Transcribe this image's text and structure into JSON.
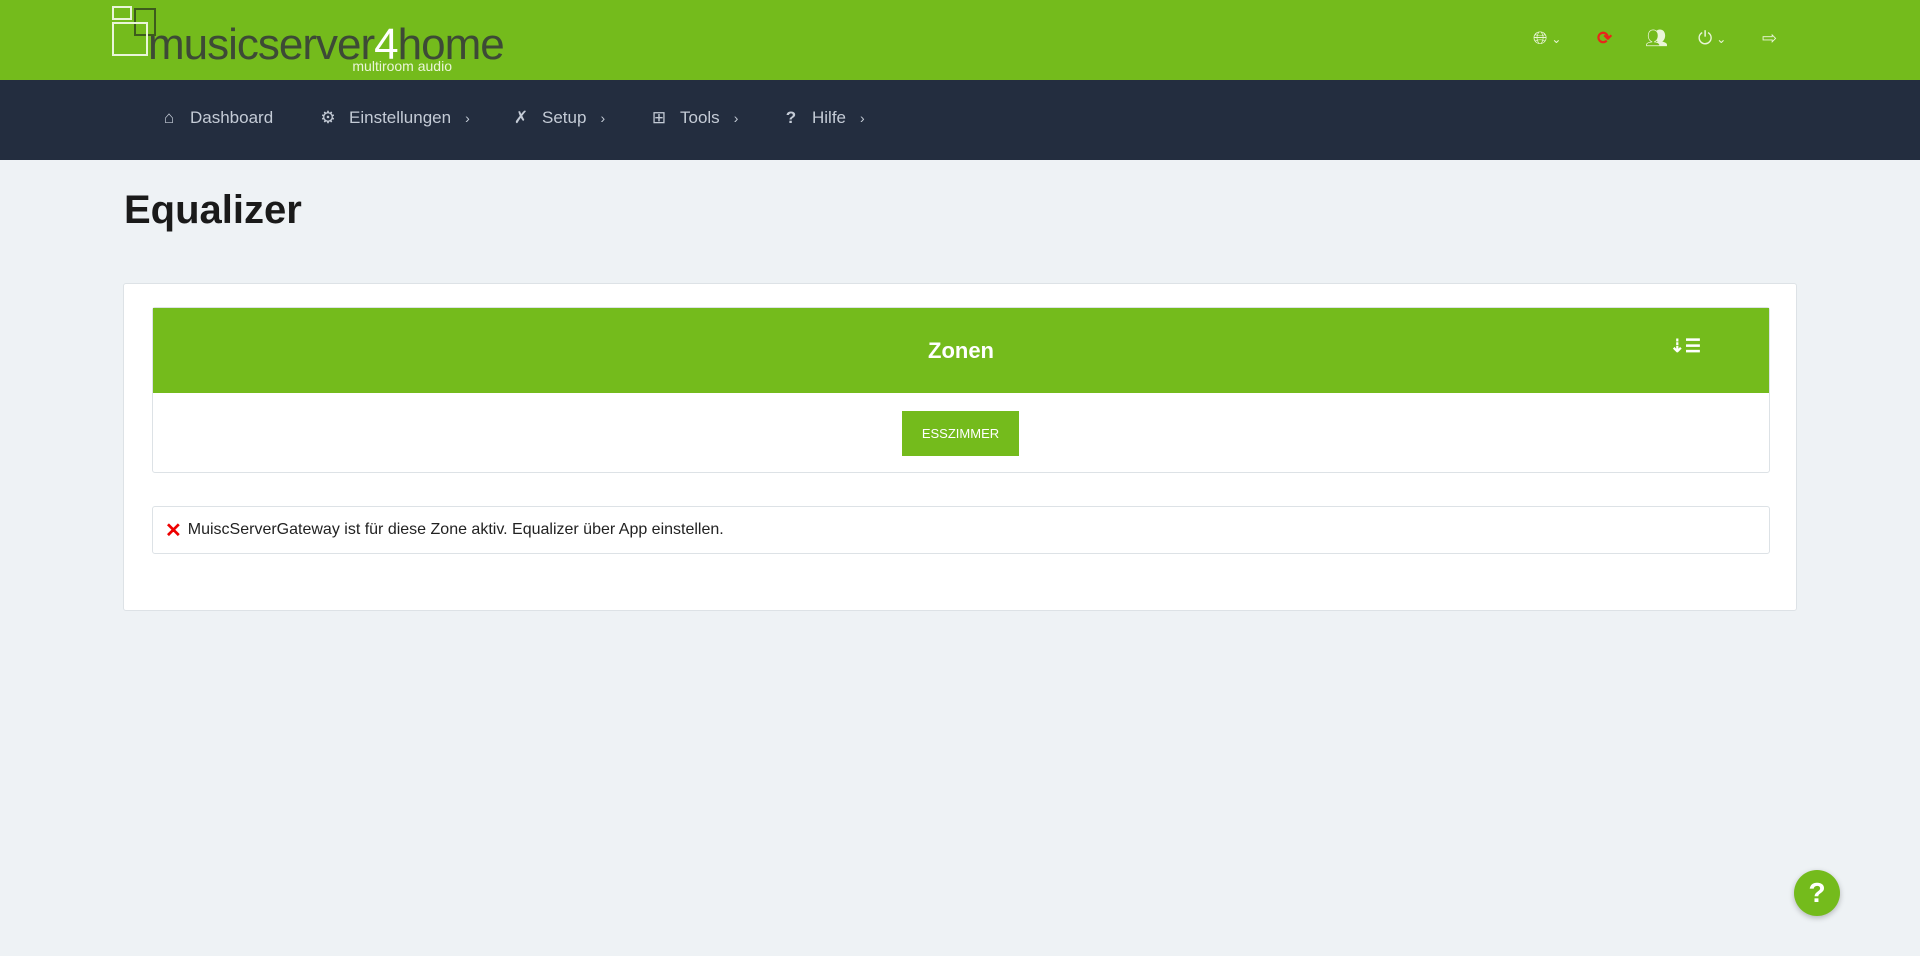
{
  "logo": {
    "brand_a": "musicserver",
    "brand_b": "4",
    "brand_c": "home",
    "tagline": "multiroom audio"
  },
  "topbar": {
    "icons": [
      "globe-icon",
      "refresh-icon",
      "users-cog-icon",
      "power-icon",
      "sign-out-icon"
    ],
    "refresh_color": "#e8261a"
  },
  "nav": {
    "items": [
      {
        "label": "Dashboard"
      },
      {
        "label": "Einstellungen"
      },
      {
        "label": "Setup"
      },
      {
        "label": "Tools"
      },
      {
        "label": "Hilfe"
      }
    ]
  },
  "page": {
    "title": "Equalizer"
  },
  "zones": {
    "title": "Zonen",
    "buttons": [
      "ESSZIMMER"
    ]
  },
  "alert": {
    "text": "MuiscServerGateway ist für diese Zone aktiv. Equalizer über App einstellen."
  },
  "help": {
    "label": "?"
  },
  "colors": {
    "accent": "#74bb1c",
    "nav": "#232d3f",
    "background": "#eef2f5"
  }
}
